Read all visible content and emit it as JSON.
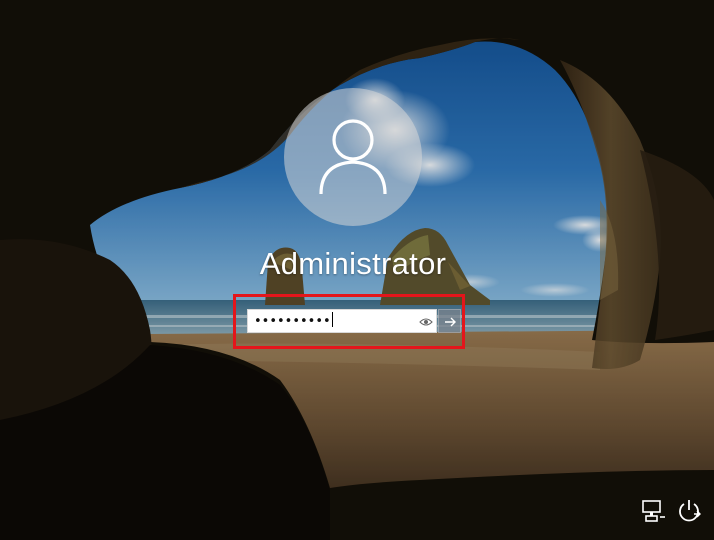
{
  "login": {
    "username": "Administrator",
    "password_masked": "••••••••••",
    "avatar_icon": "user-icon",
    "reveal_icon": "eye-icon",
    "submit_icon": "arrow-right-icon",
    "highlight_color": "#e4151b"
  },
  "system_tray": {
    "network_icon": "network-icon",
    "power_icon": "power-icon"
  }
}
